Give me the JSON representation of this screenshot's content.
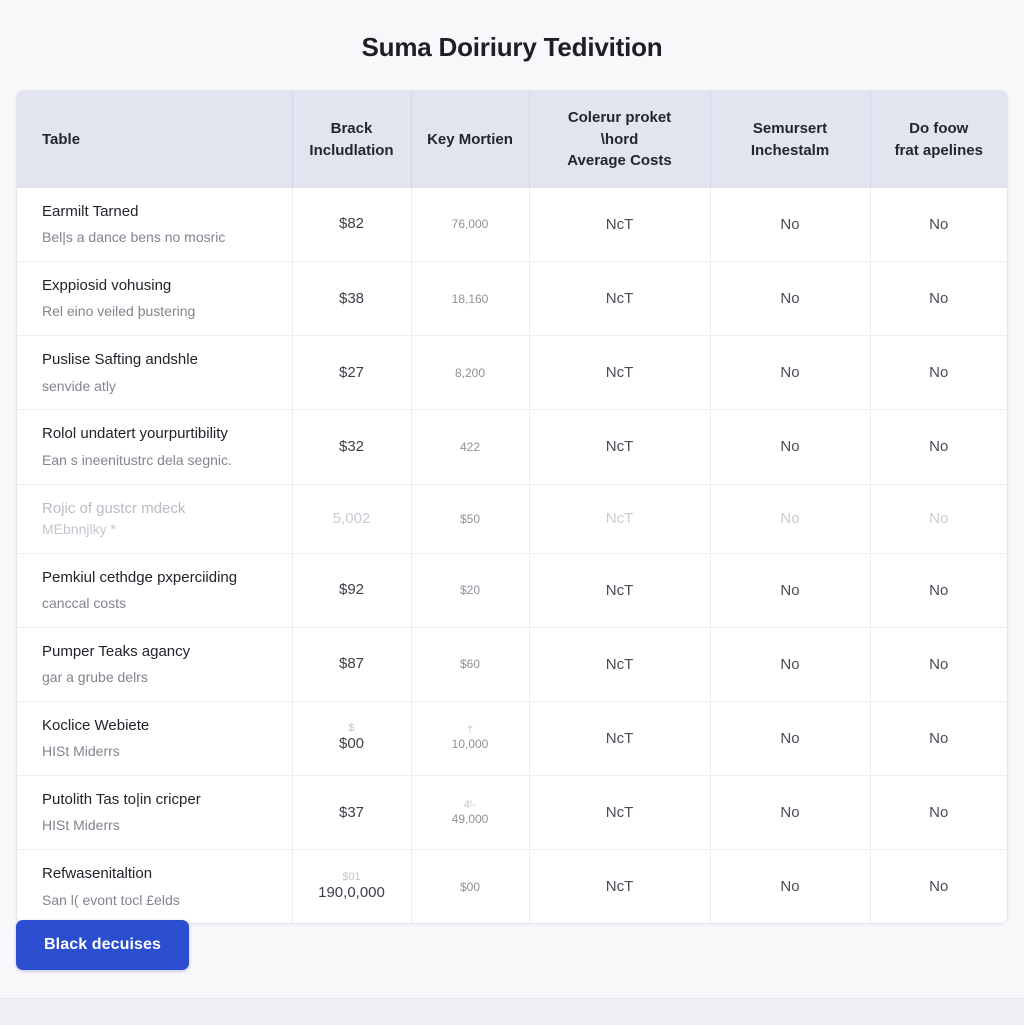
{
  "page": {
    "title": "Suma Doiriury Tedivition",
    "background_color": "#f8f8fb",
    "accent_color": "#2b4ed1",
    "header_background": "#e2e4f0"
  },
  "table": {
    "columns": [
      {
        "id": "name",
        "label": "Table",
        "lines": [
          "Table"
        ]
      },
      {
        "id": "brack",
        "label": "Brack Includlation",
        "lines": [
          "Brack",
          "Includlation"
        ]
      },
      {
        "id": "key",
        "label": "Key Mortien",
        "lines": [
          "Key Mortien"
        ]
      },
      {
        "id": "colerur",
        "label": "Colerur proket \\hord Average Costs",
        "lines": [
          "Colerur proket",
          "\\hord",
          "Average Costs"
        ]
      },
      {
        "id": "semur",
        "label": "Semursert Inchestalm",
        "lines": [
          "Semursert",
          "Inchestalm"
        ]
      },
      {
        "id": "dofoow",
        "label": "Do foow frat apelines",
        "lines": [
          "Do foow",
          "frat apelines"
        ]
      }
    ],
    "rows": [
      {
        "title": "Earmilt Tarned",
        "sub": "Bel|s a dance bens no mosric",
        "brack": "$82",
        "key": "76,000",
        "colerur": "NcT",
        "semur": "No",
        "dofoow": "No"
      },
      {
        "title": "Exppiosid vohusing",
        "sub": "Rel eino veiled þustering",
        "brack": "$38",
        "key": "18,160",
        "colerur": "NcT",
        "semur": "No",
        "dofoow": "No"
      },
      {
        "title": "Puslise Safting andshle",
        "sub": "senvide atly",
        "brack": "$27",
        "key": "8,200",
        "colerur": "NcT",
        "semur": "No",
        "dofoow": "No"
      },
      {
        "title": "Rolol undatert yourpurtibility",
        "sub": "Ean s ineenitustrc dela segnic.",
        "brack": "$32",
        "key": "422",
        "colerur": "NcT",
        "semur": "No",
        "dofoow": "No"
      },
      {
        "title": "Rojic of gustcr mdeck",
        "sub": "MEbnnjlky  *",
        "brack": "5,002",
        "key": "$50",
        "colerur": "NcT",
        "semur": "No",
        "dofoow": "No",
        "ghost": true
      },
      {
        "title": "Pemkiul cethdge pxperciiding",
        "sub": "canccal costs",
        "brack": "$92",
        "key": "$20",
        "colerur": "NcT",
        "semur": "No",
        "dofoow": "No"
      },
      {
        "title": "Pumper Teaks agancy",
        "sub": "gar a grube delrs",
        "brack": "$87",
        "key": "$60",
        "colerur": "NcT",
        "semur": "No",
        "dofoow": "No"
      },
      {
        "title": "Koclice Webiete",
        "sub": "HISt Miderrs",
        "brack_top": "$",
        "brack": "$00",
        "key_top": "†",
        "key": "10,000",
        "colerur": "NcT",
        "semur": "No",
        "dofoow": "No"
      },
      {
        "title": "Putolith Tas to|in cricper",
        "sub": "HISt Miderrs",
        "brack": "$37",
        "key_top": "4ᵗ-",
        "key": "49,000",
        "colerur": "NcT",
        "semur": "No",
        "dofoow": "No"
      },
      {
        "title": "Refwasenitaltion",
        "sub": "San l( evont tocl £elds",
        "brack_top": "$01",
        "brack": "190,0,000",
        "key": "$00",
        "colerur": "NcT",
        "semur": "No",
        "dofoow": "No"
      }
    ]
  },
  "actions": {
    "primary_button": "Black decuises"
  }
}
